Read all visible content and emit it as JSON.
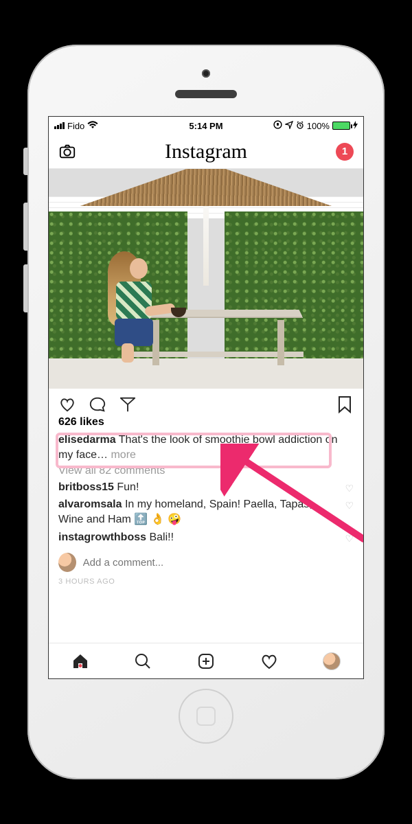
{
  "status": {
    "carrier": "Fido",
    "time": "5:14 PM",
    "battery_pct": "100%"
  },
  "header": {
    "logo": "Instagram",
    "dm_badge": "1"
  },
  "post": {
    "likes_label": "626 likes",
    "caption_user": "elisedarma",
    "caption_text": "That's the look of smoothie bowl addiction on my face… ",
    "more_label": "more",
    "view_all": "View all 82 comments",
    "comments": [
      {
        "user": "britboss15",
        "text": "Fun!"
      },
      {
        "user": "alvaromsala",
        "text": "In my homeland, Spain! Paella, Tapas, Wine and Ham 🔝 👌 🤪"
      },
      {
        "user": "instagrowthboss",
        "text": "Bali!!"
      }
    ],
    "add_comment_placeholder": "Add a comment...",
    "time_ago": "3 HOURS AGO"
  }
}
